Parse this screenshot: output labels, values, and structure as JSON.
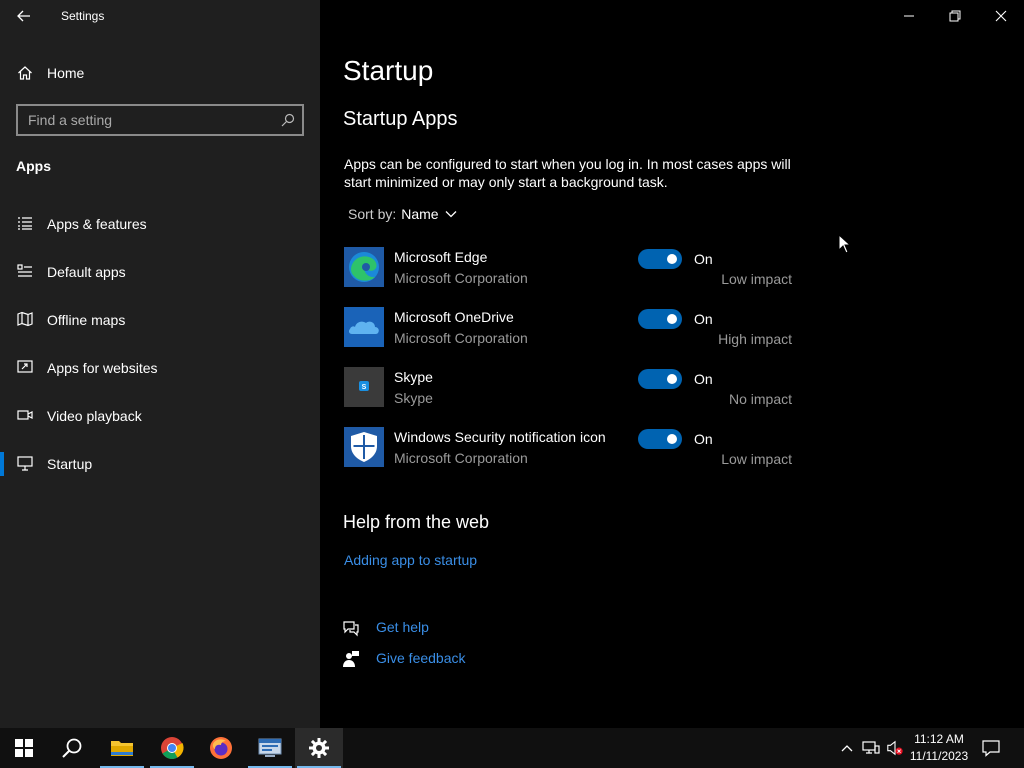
{
  "window": {
    "title": "Settings"
  },
  "sidebar": {
    "home_label": "Home",
    "search_placeholder": "Find a setting",
    "section_title": "Apps",
    "items": [
      {
        "label": "Apps & features",
        "icon": "list-icon"
      },
      {
        "label": "Default apps",
        "icon": "default-apps-icon"
      },
      {
        "label": "Offline maps",
        "icon": "map-icon"
      },
      {
        "label": "Apps for websites",
        "icon": "link-window-icon"
      },
      {
        "label": "Video playback",
        "icon": "video-icon"
      },
      {
        "label": "Startup",
        "icon": "startup-icon",
        "selected": true
      }
    ]
  },
  "main": {
    "title": "Startup",
    "subtitle": "Startup Apps",
    "description": "Apps can be configured to start when you log in. In most cases apps will start minimized or may only start a background task.",
    "sort_label": "Sort by:",
    "sort_value": "Name",
    "apps": [
      {
        "name": "Microsoft Edge",
        "publisher": "Microsoft Corporation",
        "state": "On",
        "impact": "Low impact",
        "icon": "edge-icon"
      },
      {
        "name": "Microsoft OneDrive",
        "publisher": "Microsoft Corporation",
        "state": "On",
        "impact": "High impact",
        "icon": "onedrive-icon"
      },
      {
        "name": "Skype",
        "publisher": "Skype",
        "state": "On",
        "impact": "No impact",
        "icon": "skype-icon"
      },
      {
        "name": "Windows Security notification icon",
        "publisher": "Microsoft Corporation",
        "state": "On",
        "impact": "Low impact",
        "icon": "windows-security-icon"
      }
    ],
    "help_title": "Help from the web",
    "help_link": "Adding app to startup",
    "get_help": "Get help",
    "give_feedback": "Give feedback"
  },
  "taskbar": {
    "time": "11:12 AM",
    "date": "11/11/2023"
  },
  "colors": {
    "accent": "#0078d7",
    "toggle_on": "#0063b1",
    "link": "#3a8ee6",
    "sidebar_bg": "#1f1f1f",
    "main_bg": "#000000",
    "taskbar_bg": "#101010"
  }
}
